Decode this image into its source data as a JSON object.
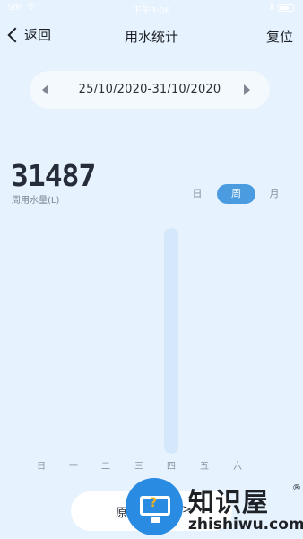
{
  "status_bar": {
    "carrier": "SIM",
    "time": "下午3:06",
    "icons": [
      "signal-icon",
      "wifi-icon",
      "bluetooth-icon",
      "battery-icon"
    ]
  },
  "nav": {
    "back_label": "返回",
    "title": "用水统计",
    "reset_label": "复位"
  },
  "date_range": {
    "text": "25/10/2020-31/10/2020"
  },
  "summary": {
    "total": "31487",
    "label": "周用水量(L)"
  },
  "period_toggle": {
    "options": [
      "日",
      "周",
      "月"
    ],
    "selected": "周"
  },
  "chart_data": {
    "type": "bar",
    "categories": [
      "日",
      "一",
      "二",
      "三",
      "四",
      "五",
      "六"
    ],
    "values": [
      0,
      0,
      0,
      0,
      31487,
      0,
      0
    ],
    "ylim": [
      0,
      31487
    ],
    "colors": {
      "bar": "#d5e8fb"
    }
  },
  "bottom_button": {
    "label_start": "原",
    "label_end": ">"
  },
  "watermark": {
    "chinese": "知识屋",
    "registered": "®",
    "domain": "zhishiwu.com",
    "badge_glyph": "?"
  },
  "colors": {
    "background": "#e6f2fd",
    "accent": "#4a9be0",
    "bar": "#d5e8fb"
  }
}
